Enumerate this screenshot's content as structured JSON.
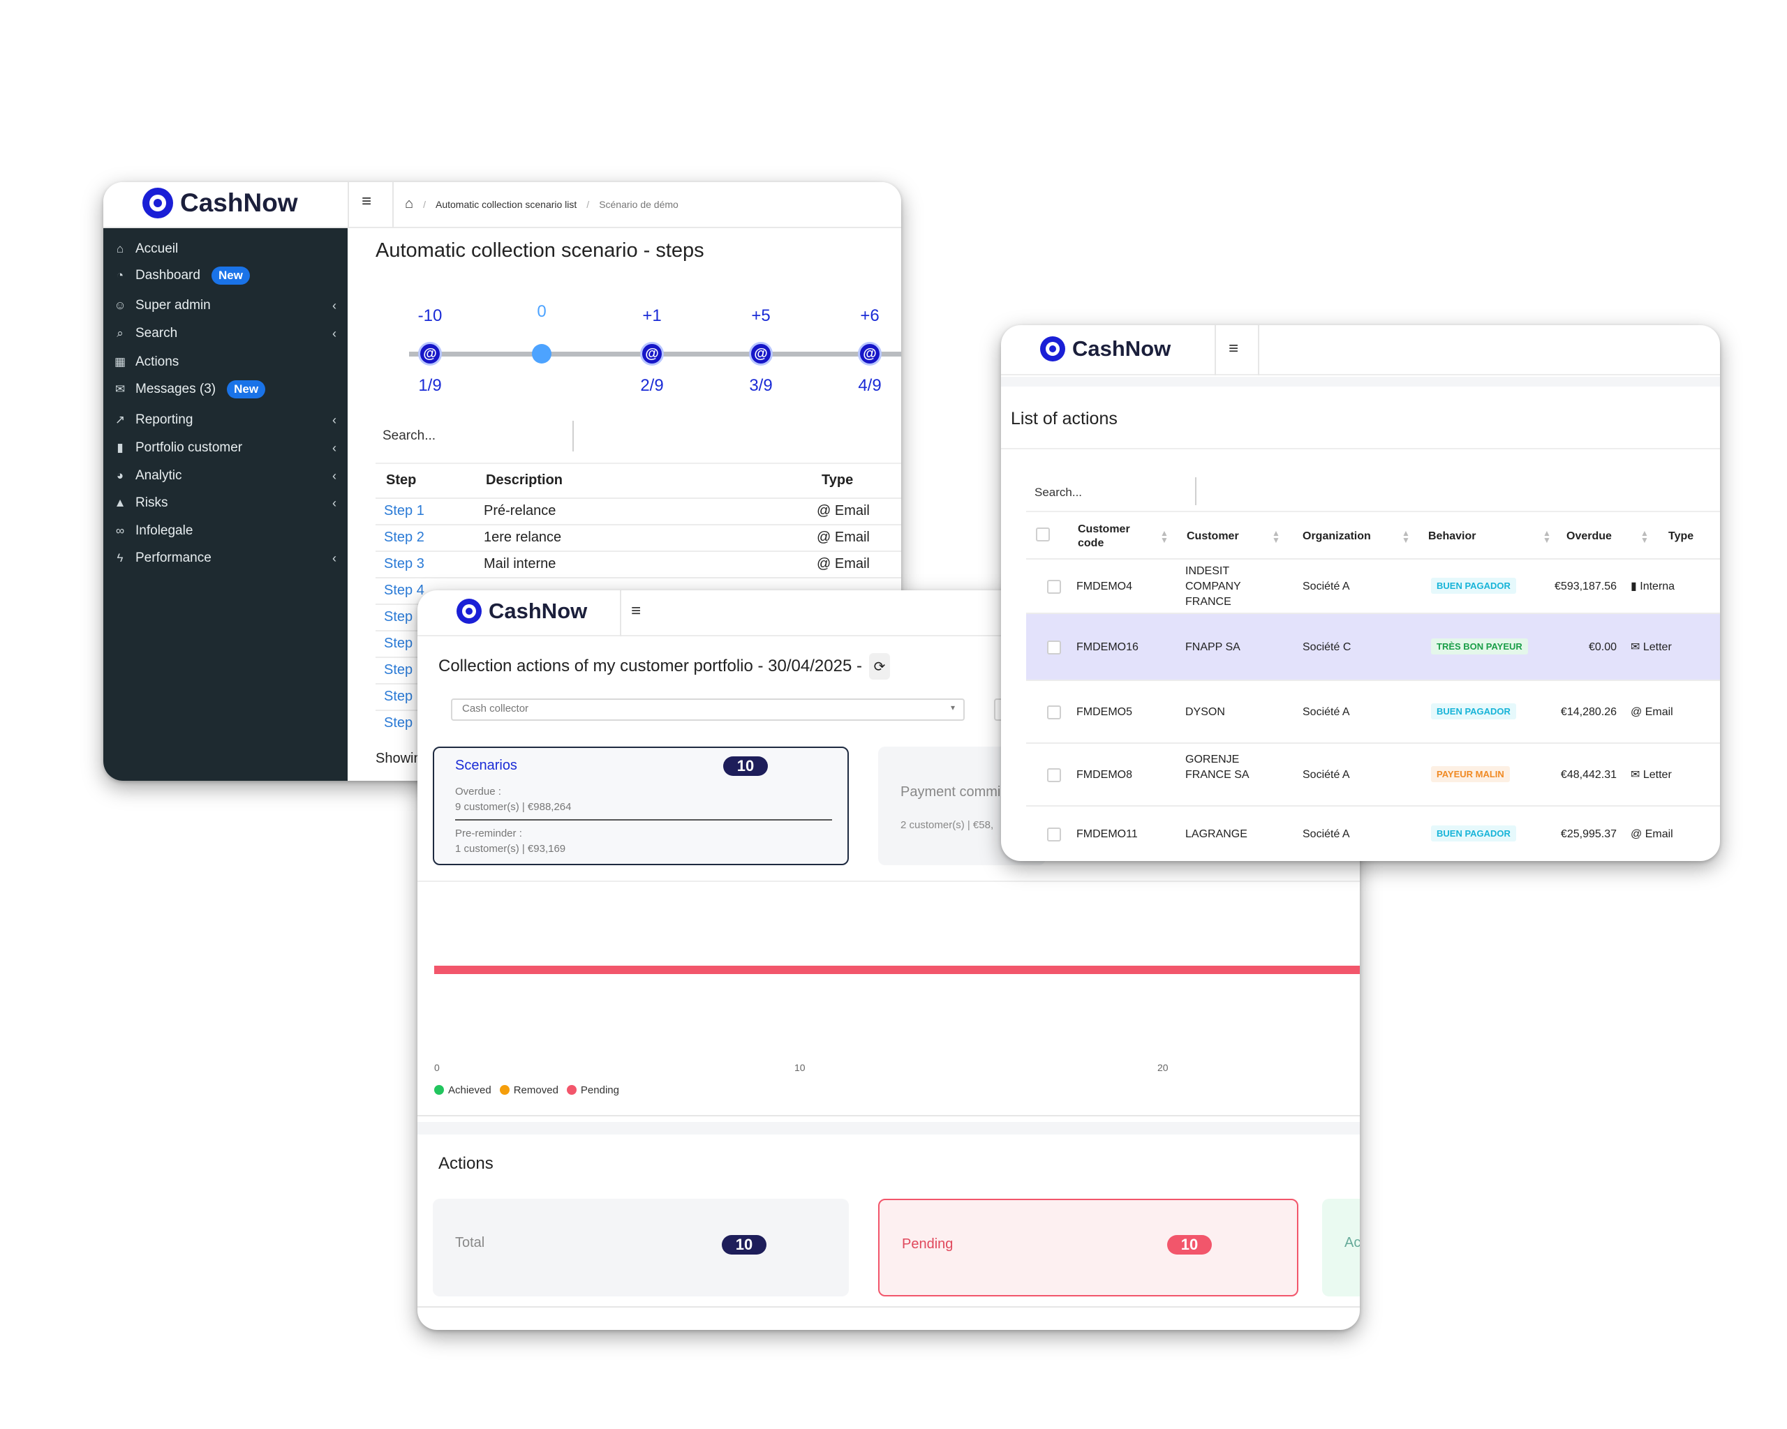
{
  "app": {
    "name": "CashNow"
  },
  "colors": {
    "brand": "#1a1fd6",
    "sidebar": "#1e2a30",
    "link": "#2a7ad6",
    "pending": "#f2566b",
    "achieved": "#22c55e",
    "removed": "#f59e0b",
    "new_badge": "#1a73e8"
  },
  "w1": {
    "breadcrumb": [
      "Automatic collection scenario list",
      "Scénario de démo"
    ],
    "sidebar": [
      {
        "label": "Accueil",
        "icon": "home-icon",
        "chevron": false,
        "badge": ""
      },
      {
        "label": "Dashboard",
        "icon": "dashboard-icon",
        "chevron": false,
        "badge": "New"
      },
      {
        "label": "Super admin",
        "icon": "user-admin-icon",
        "chevron": true,
        "badge": ""
      },
      {
        "label": "Search",
        "icon": "search-icon",
        "chevron": true,
        "badge": ""
      },
      {
        "label": "Actions",
        "icon": "calendar-icon",
        "chevron": false,
        "badge": ""
      },
      {
        "label": "Messages (3)",
        "icon": "messages-icon",
        "chevron": false,
        "badge": "New"
      },
      {
        "label": "Reporting",
        "icon": "chart-icon",
        "chevron": true,
        "badge": ""
      },
      {
        "label": "Portfolio customer",
        "icon": "portfolio-icon",
        "chevron": true,
        "badge": ""
      },
      {
        "label": "Analytic",
        "icon": "pie-icon",
        "chevron": true,
        "badge": ""
      },
      {
        "label": "Risks",
        "icon": "warning-icon",
        "chevron": true,
        "badge": ""
      },
      {
        "label": "Infolegale",
        "icon": "binoculars-icon",
        "chevron": false,
        "badge": ""
      },
      {
        "label": "Performance",
        "icon": "bolt-icon",
        "chevron": true,
        "badge": ""
      }
    ],
    "title": "Automatic collection scenario - steps",
    "timeline": [
      {
        "top": "-10",
        "bottom": "1/9",
        "kind": "email",
        "glyph": "@"
      },
      {
        "top": "0",
        "bottom": "",
        "kind": "today",
        "glyph": ""
      },
      {
        "top": "+1",
        "bottom": "2/9",
        "kind": "email",
        "glyph": "@"
      },
      {
        "top": "+5",
        "bottom": "3/9",
        "kind": "email",
        "glyph": "@"
      },
      {
        "top": "+6",
        "bottom": "4/9",
        "kind": "email",
        "glyph": "@"
      }
    ],
    "search_placeholder": "Search...",
    "columns": [
      "Step",
      "Description",
      "Type"
    ],
    "steps": [
      {
        "step": "Step 1",
        "description": "Pré-relance",
        "type": "@ Email"
      },
      {
        "step": "Step 2",
        "description": "1ere relance",
        "type": "@ Email"
      },
      {
        "step": "Step 3",
        "description": "Mail interne",
        "type": "@ Email"
      },
      {
        "step": "Step 4",
        "description": "",
        "type": ""
      },
      {
        "step": "Step",
        "description": "",
        "type": ""
      },
      {
        "step": "Step",
        "description": "",
        "type": ""
      },
      {
        "step": "Step",
        "description": "",
        "type": ""
      },
      {
        "step": "Step",
        "description": "",
        "type": ""
      },
      {
        "step": "Step",
        "description": "",
        "type": ""
      }
    ],
    "showing": "Showin"
  },
  "w2": {
    "title": "Collection actions of my customer portfolio - 30/04/2025 -",
    "refresh_glyph": "⟳",
    "cash_collector_placeholder": "Cash collector",
    "scenarios": {
      "label": "Scenarios",
      "count": "10",
      "overdue_label": "Overdue :",
      "overdue_value": "9 customer(s) | €988,264",
      "prereminder_label": "Pre-reminder :",
      "prereminder_value": "1 customer(s) | €93,169"
    },
    "payment": {
      "label": "Payment commi",
      "value": "2 customer(s) | €58,"
    },
    "chart_data": {
      "type": "bar",
      "orientation": "horizontal",
      "xlim": [
        0,
        25
      ],
      "ticks": [
        "0",
        "10",
        "20"
      ],
      "series": [
        {
          "name": "Achieved",
          "value": 0
        },
        {
          "name": "Removed",
          "value": 0
        },
        {
          "name": "Pending",
          "value": 10
        }
      ],
      "legend": [
        "Achieved",
        "Removed",
        "Pending"
      ]
    },
    "actions_title": "Actions",
    "total": {
      "label": "Total",
      "count": "10"
    },
    "pending": {
      "label": "Pending",
      "count": "10"
    },
    "achieved": {
      "label": "Ac"
    }
  },
  "w3": {
    "title": "List of actions",
    "search_placeholder": "Search...",
    "columns": [
      "Customer code",
      "Customer",
      "Organization",
      "Behavior",
      "Overdue",
      "Type"
    ],
    "rows": [
      {
        "code": "FMDEMO4",
        "customer": "INDESIT COMPANY FRANCE",
        "org": "Société A",
        "behavior": "BUEN PAGADOR",
        "behavior_color": "cyan",
        "overdue": "€593,187.56",
        "type": "Interna",
        "type_icon": "building-icon",
        "type_glyph": "▮",
        "highlight": false
      },
      {
        "code": "FMDEMO16",
        "customer": "FNAPP SA",
        "org": "Société C",
        "behavior": "TRÈS BON PAYEUR",
        "behavior_color": "green",
        "overdue": "€0.00",
        "type": "Letter",
        "type_icon": "envelope-icon",
        "type_glyph": "✉",
        "highlight": true
      },
      {
        "code": "FMDEMO5",
        "customer": "DYSON",
        "org": "Société A",
        "behavior": "BUEN PAGADOR",
        "behavior_color": "cyan",
        "overdue": "€14,280.26",
        "type": "Email",
        "type_icon": "at-icon",
        "type_glyph": "@",
        "highlight": false
      },
      {
        "code": "FMDEMO8",
        "customer": "GORENJE FRANCE SA",
        "org": "Société A",
        "behavior": "PAYEUR MALIN",
        "behavior_color": "orange",
        "overdue": "€48,442.31",
        "type": "Letter",
        "type_icon": "envelope-icon",
        "type_glyph": "✉",
        "highlight": false
      },
      {
        "code": "FMDEMO11",
        "customer": "LAGRANGE",
        "org": "Société A",
        "behavior": "BUEN PAGADOR",
        "behavior_color": "cyan",
        "overdue": "€25,995.37",
        "type": "Email",
        "type_icon": "at-icon",
        "type_glyph": "@",
        "highlight": false
      }
    ]
  }
}
